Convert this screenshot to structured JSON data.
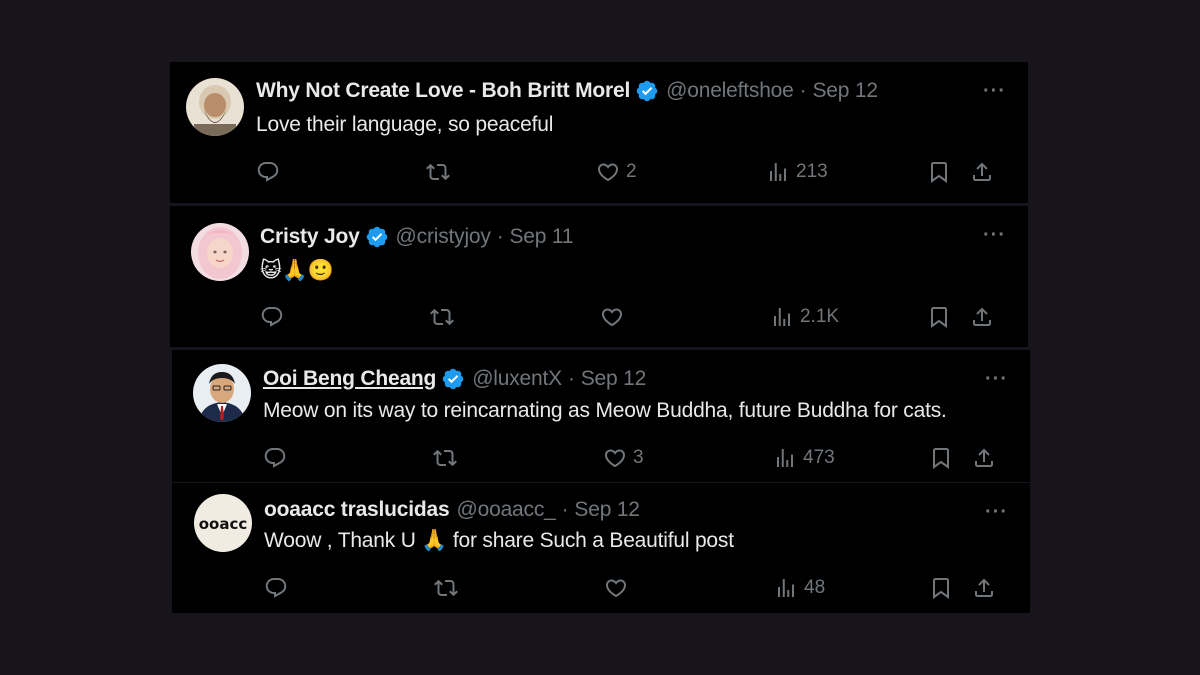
{
  "replies": [
    {
      "name": "Why Not Create Love - Boh Britt Morel",
      "handle": "@oneleftshoe",
      "separator": "·",
      "date": "Sep 12",
      "text": "Love their language, so peaceful",
      "likes": "2",
      "views": "213",
      "verified": true
    },
    {
      "name": "Cristy Joy",
      "handle": "@cristyjoy",
      "separator": "·",
      "date": "Sep 11",
      "text": "😺🙏🙂",
      "likes": "",
      "views": "2.1K",
      "verified": true
    },
    {
      "name": "Ooi Beng Cheang",
      "handle": "@luxentX",
      "separator": "·",
      "date": "Sep 12",
      "text": "Meow on its way to reincarnating as Meow Buddha, future Buddha for cats.",
      "likes": "3",
      "views": "473",
      "verified": true
    },
    {
      "name": "ooaacc traslucidas",
      "handle": "@ooaacc_",
      "separator": "·",
      "date": "Sep 12",
      "text": "Woow ,  Thank U 🙏 for share Such a Beautiful  post",
      "likes": "",
      "views": "48",
      "verified": false,
      "avatar_text": "ooacc"
    }
  ],
  "more_label": "···",
  "colors": {
    "background": "#17141b",
    "card": "#000000",
    "text": "#e7e9ea",
    "muted": "#71767b",
    "verified": "#1d9bf0"
  },
  "icons": [
    "reply-icon",
    "retweet-icon",
    "like-icon",
    "views-icon",
    "bookmark-icon",
    "share-icon",
    "verified-badge-icon",
    "more-icon"
  ]
}
